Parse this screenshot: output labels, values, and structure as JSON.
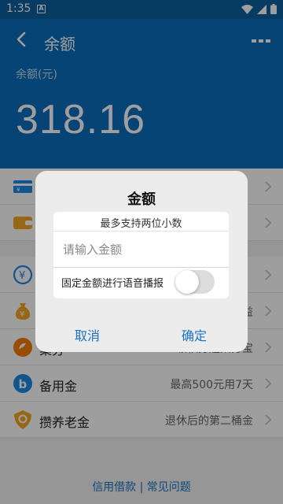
{
  "status_bar": {
    "time": "1:35",
    "notification_letter": "A"
  },
  "header": {
    "title": "余额",
    "balance_label": "余额(元)",
    "balance_value": "318.16"
  },
  "rows": [
    {
      "label": "",
      "description": "",
      "icon": "card-icon",
      "color": "#1e88e5"
    },
    {
      "label": "",
      "description": "",
      "icon": "wallet-icon",
      "color": "#f5a623"
    },
    {
      "label": "",
      "description": "",
      "icon": "yen-coin-icon",
      "color": "#1e88e5"
    },
    {
      "label": "",
      "description": "",
      "icon": "money-bag-icon",
      "color": "#f5a623"
    },
    {
      "label": "",
      "description": "",
      "icon": "bean-icon",
      "color": "#f57c00"
    },
    {
      "label": "备用金",
      "description": "最高500元用7天",
      "icon": "b-circle-icon",
      "color": "#1e88e5"
    },
    {
      "label": "攒养老金",
      "description": "退休后的第二桶金",
      "icon": "shield-icon",
      "color": "#f5a623"
    }
  ],
  "partial_text": {
    "row4_right": "益",
    "row5_left": "集分",
    "row5_right": "领积分超集分宝"
  },
  "footer": {
    "links": "信用借款 | 常见问题"
  },
  "dialog": {
    "title": "金额",
    "hint": "最多支持两位小数",
    "input_placeholder": "请输入金额",
    "toggle_label": "固定金额进行语音播报",
    "toggle_on": false,
    "cancel_label": "取消",
    "confirm_label": "确定"
  }
}
